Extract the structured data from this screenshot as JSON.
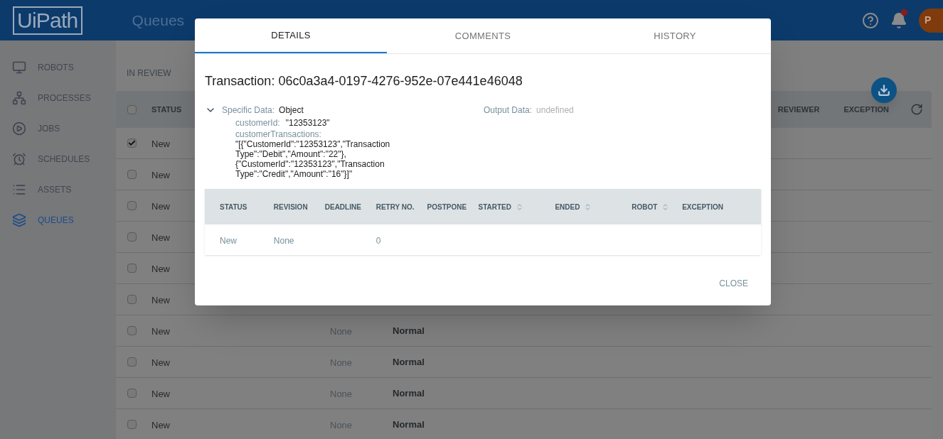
{
  "header": {
    "logo": "UiPath",
    "breadcrumb": [
      "Queues"
    ],
    "avatar": "P",
    "notification": true
  },
  "sidebar": {
    "items": [
      {
        "label": "ROBOTS",
        "selected": false
      },
      {
        "label": "PROCESSES",
        "selected": false
      },
      {
        "label": "JOBS",
        "selected": false
      },
      {
        "label": "SCHEDULES",
        "selected": false
      },
      {
        "label": "ASSETS",
        "selected": false
      },
      {
        "label": "QUEUES",
        "selected": true
      }
    ]
  },
  "view_tabs": [
    "IN REVIEW"
  ],
  "table": {
    "select_all_checked": false,
    "columns": [
      "STATUS",
      "REVIEWER",
      "EXCEPTION"
    ],
    "rows": [
      {
        "checked": true,
        "status": "New"
      },
      {
        "checked": false,
        "status": "New"
      },
      {
        "checked": false,
        "status": "New"
      },
      {
        "checked": false,
        "status": "New"
      },
      {
        "checked": false,
        "status": "New"
      },
      {
        "checked": false,
        "status": "New"
      },
      {
        "checked": false,
        "status": "New",
        "column_3": "None",
        "column_4": "Normal"
      },
      {
        "checked": false,
        "status": "New",
        "column_3": "None",
        "column_4": "Normal"
      },
      {
        "checked": false,
        "status": "New",
        "column_3": "None",
        "column_4": "Normal"
      },
      {
        "checked": false,
        "status": "New",
        "column_3": "None",
        "column_4": "Normal"
      }
    ]
  },
  "dialog": {
    "tabs": [
      {
        "label": "DETAILS",
        "selected": true
      },
      {
        "label": "COMMENTS",
        "selected": false
      },
      {
        "label": "HISTORY",
        "selected": false
      }
    ],
    "title": "Transaction: 06c0a3a4-0197-4276-952e-07e441e46048",
    "specific_data": {
      "label": "Specific Data:",
      "value": "Object",
      "expanded": true,
      "fields": [
        {
          "key": "customerId:",
          "value": "\"12353123\""
        },
        {
          "key": "customerTransactions:",
          "value": "\"[{\"CustomerId\":\"12353123\",\"Transaction Type\":\"Debit\",\"Amount\":\"22\"},{\"CustomerId\":\"12353123\",\"Transaction Type\":\"Credit\",\"Amount\":\"16\"}]\""
        }
      ]
    },
    "output_data": {
      "label": "Output Data:",
      "value": "undefined"
    },
    "history_table": {
      "columns": [
        {
          "label": "STATUS",
          "sortable": false
        },
        {
          "label": "REVISION",
          "sortable": false
        },
        {
          "label": "DEADLINE",
          "sortable": false
        },
        {
          "label": "RETRY NO.",
          "sortable": false
        },
        {
          "label": "POSTPONE",
          "sortable": false
        },
        {
          "label": "STARTED",
          "sortable": true
        },
        {
          "label": "ENDED",
          "sortable": true
        },
        {
          "label": "ROBOT",
          "sortable": true
        },
        {
          "label": "EXCEPTION",
          "sortable": false
        }
      ],
      "rows": [
        [
          "New",
          "None",
          "",
          "0",
          "",
          "",
          "",
          "",
          ""
        ]
      ]
    },
    "close_button": "CLOSE"
  }
}
